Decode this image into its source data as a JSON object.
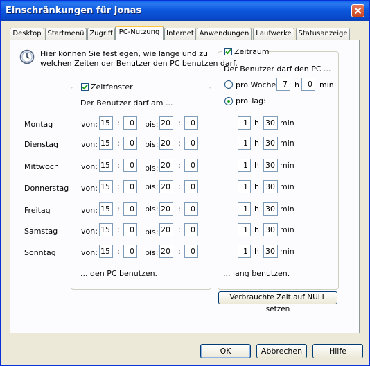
{
  "window": {
    "title": "Einschränkungen für Jonas"
  },
  "tabs": [
    "Desktop",
    "Startmenü",
    "Zugriff",
    "PC-Nutzung",
    "Internet",
    "Anwendungen",
    "Laufwerke",
    "Statusanzeige"
  ],
  "active_tab": "PC-Nutzung",
  "intro": {
    "line1": "Hier können Sie festlegen, wie lange und zu",
    "line2": "welchen Zeiten der Benutzer  den PC benutzen darf."
  },
  "zeitfenster": {
    "label": "Zeitfenster",
    "checked": true,
    "header": "Der Benutzer darf am ...",
    "footer": "... den PC benutzen.",
    "from_label": "von:",
    "to_label": "bis:",
    "colon": ":"
  },
  "days": [
    {
      "name": "Montag",
      "from_h": "15",
      "from_m": "0",
      "to_h": "20",
      "to_m": "0",
      "hours": "1",
      "minutes": "30"
    },
    {
      "name": "Dienstag",
      "from_h": "15",
      "from_m": "0",
      "to_h": "20",
      "to_m": "0",
      "hours": "1",
      "minutes": "30"
    },
    {
      "name": "Mittwoch",
      "from_h": "15",
      "from_m": "0",
      "to_h": "20",
      "to_m": "0",
      "hours": "1",
      "minutes": "30"
    },
    {
      "name": "Donnerstag",
      "from_h": "15",
      "from_m": "0",
      "to_h": "20",
      "to_m": "0",
      "hours": "1",
      "minutes": "30"
    },
    {
      "name": "Freitag",
      "from_h": "15",
      "from_m": "0",
      "to_h": "20",
      "to_m": "0",
      "hours": "1",
      "minutes": "30"
    },
    {
      "name": "Samstag",
      "from_h": "15",
      "from_m": "0",
      "to_h": "20",
      "to_m": "0",
      "hours": "1",
      "minutes": "30"
    },
    {
      "name": "Sonntag",
      "from_h": "15",
      "from_m": "0",
      "to_h": "20",
      "to_m": "0",
      "hours": "1",
      "minutes": "30"
    }
  ],
  "zeitraum": {
    "label": "Zeitraum",
    "checked": true,
    "header": "Der Benutzer darf den PC ...",
    "pro_woche_label": "pro Woche",
    "pro_woche_selected": false,
    "pro_woche_hours": "7",
    "pro_woche_minutes": "0",
    "pro_tag_label": "pro Tag:",
    "pro_tag_selected": true,
    "h_unit": "h",
    "min_unit": "min",
    "footer": "... lang benutzen.",
    "reset_button": "Verbrauchte Zeit auf NULL setzen"
  },
  "buttons": {
    "ok": "OK",
    "cancel": "Abbrechen",
    "help": "Hilfe"
  },
  "colors": {
    "titlebar": "#0a5fe6",
    "panel": "#fcfcfe",
    "window": "#ece9d8",
    "active_tab_accent": "#ffc83c",
    "check": "#21a121"
  }
}
